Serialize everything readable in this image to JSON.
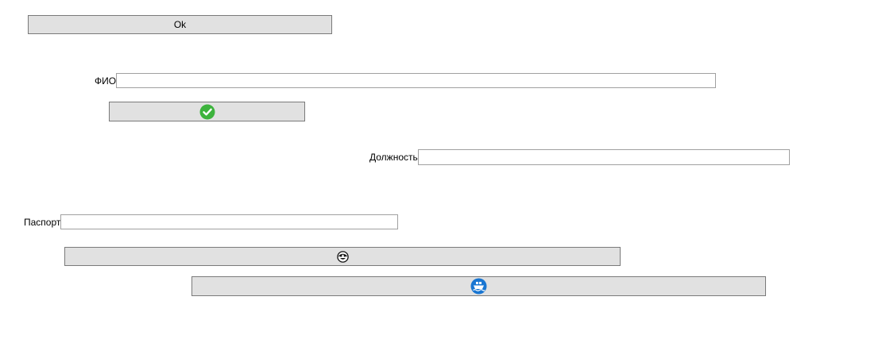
{
  "buttons": {
    "ok_label": "Ok",
    "confirm_icon": "check-circle-icon",
    "face_icon": "smiley-face-icon",
    "ship_icon": "ship-icon"
  },
  "fields": {
    "fio": {
      "label": "ФИО",
      "value": ""
    },
    "position": {
      "label": "Должность",
      "value": ""
    },
    "passport": {
      "label": "Паспорт",
      "value": ""
    }
  },
  "colors": {
    "button_bg": "#e1e1e1",
    "button_border": "#7a7a7a",
    "check_green": "#3db33d",
    "ship_blue": "#1976d2"
  }
}
